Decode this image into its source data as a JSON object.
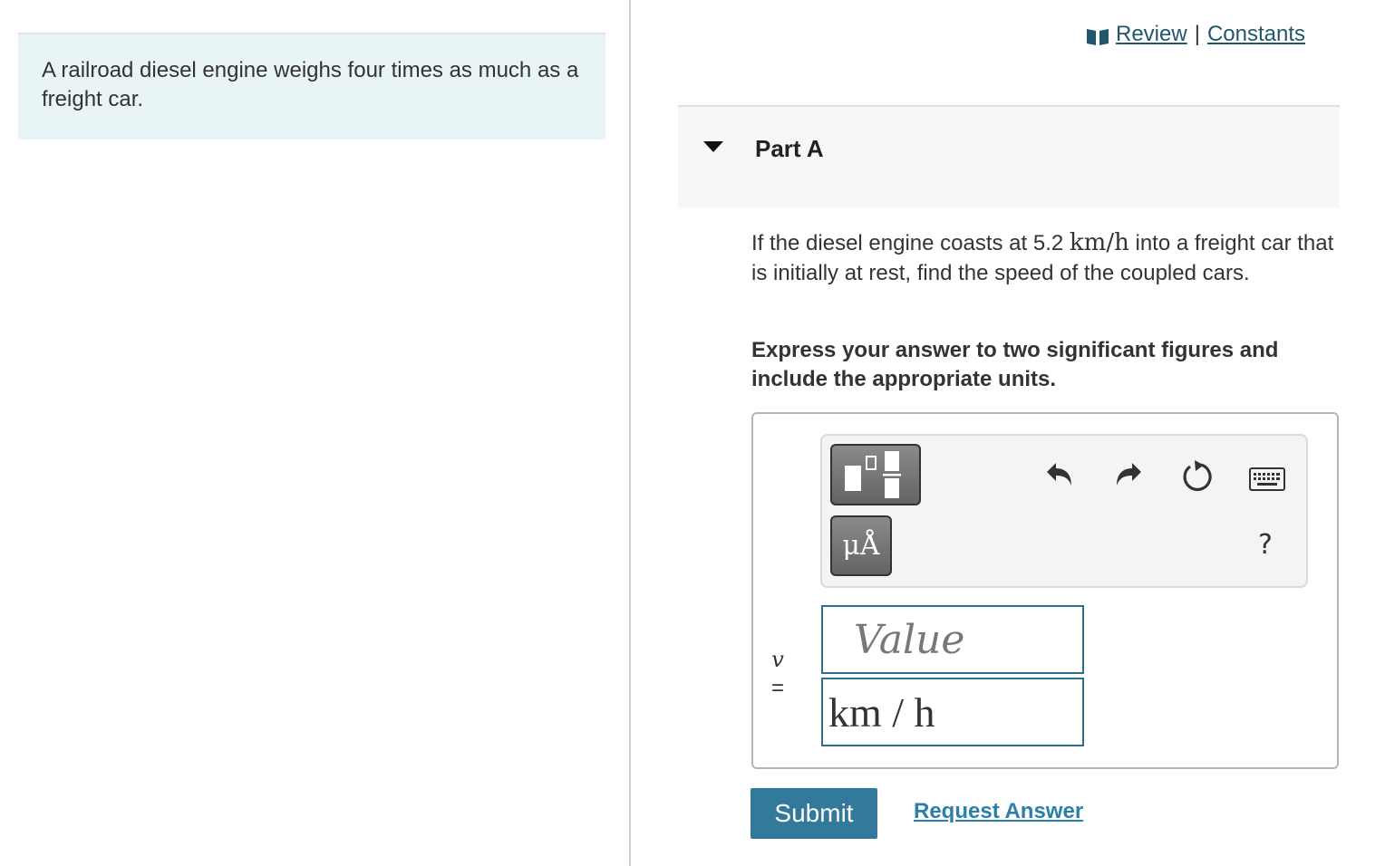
{
  "problem": {
    "text": "A railroad diesel engine weighs four times as much as a freight car."
  },
  "top_links": {
    "review": "Review",
    "separator": "|",
    "constants": "Constants"
  },
  "part": {
    "title": "Part A",
    "question_before": "If the diesel engine coasts at 5.2 ",
    "question_unit": "km/h",
    "question_after": " into a freight car that is initially at rest, find the speed of the coupled cars.",
    "instruction": "Express your answer to two significant figures and include the appropriate units."
  },
  "toolbar": {
    "units_glyph": "μÅ",
    "help": "?",
    "icons": [
      "templates-icon",
      "units-icon",
      "undo-icon",
      "redo-icon",
      "reset-icon",
      "keyboard-icon",
      "help-icon"
    ]
  },
  "answer": {
    "variable": "v",
    "equals": "=",
    "value_placeholder": "Value",
    "value": "",
    "units_value": "km / h"
  },
  "actions": {
    "submit": "Submit",
    "request_answer": "Request Answer"
  },
  "colors": {
    "link": "#22566b",
    "submit_bg": "#33799c",
    "input_border": "#2e6f8e",
    "problem_bg": "#e9f4f6"
  }
}
